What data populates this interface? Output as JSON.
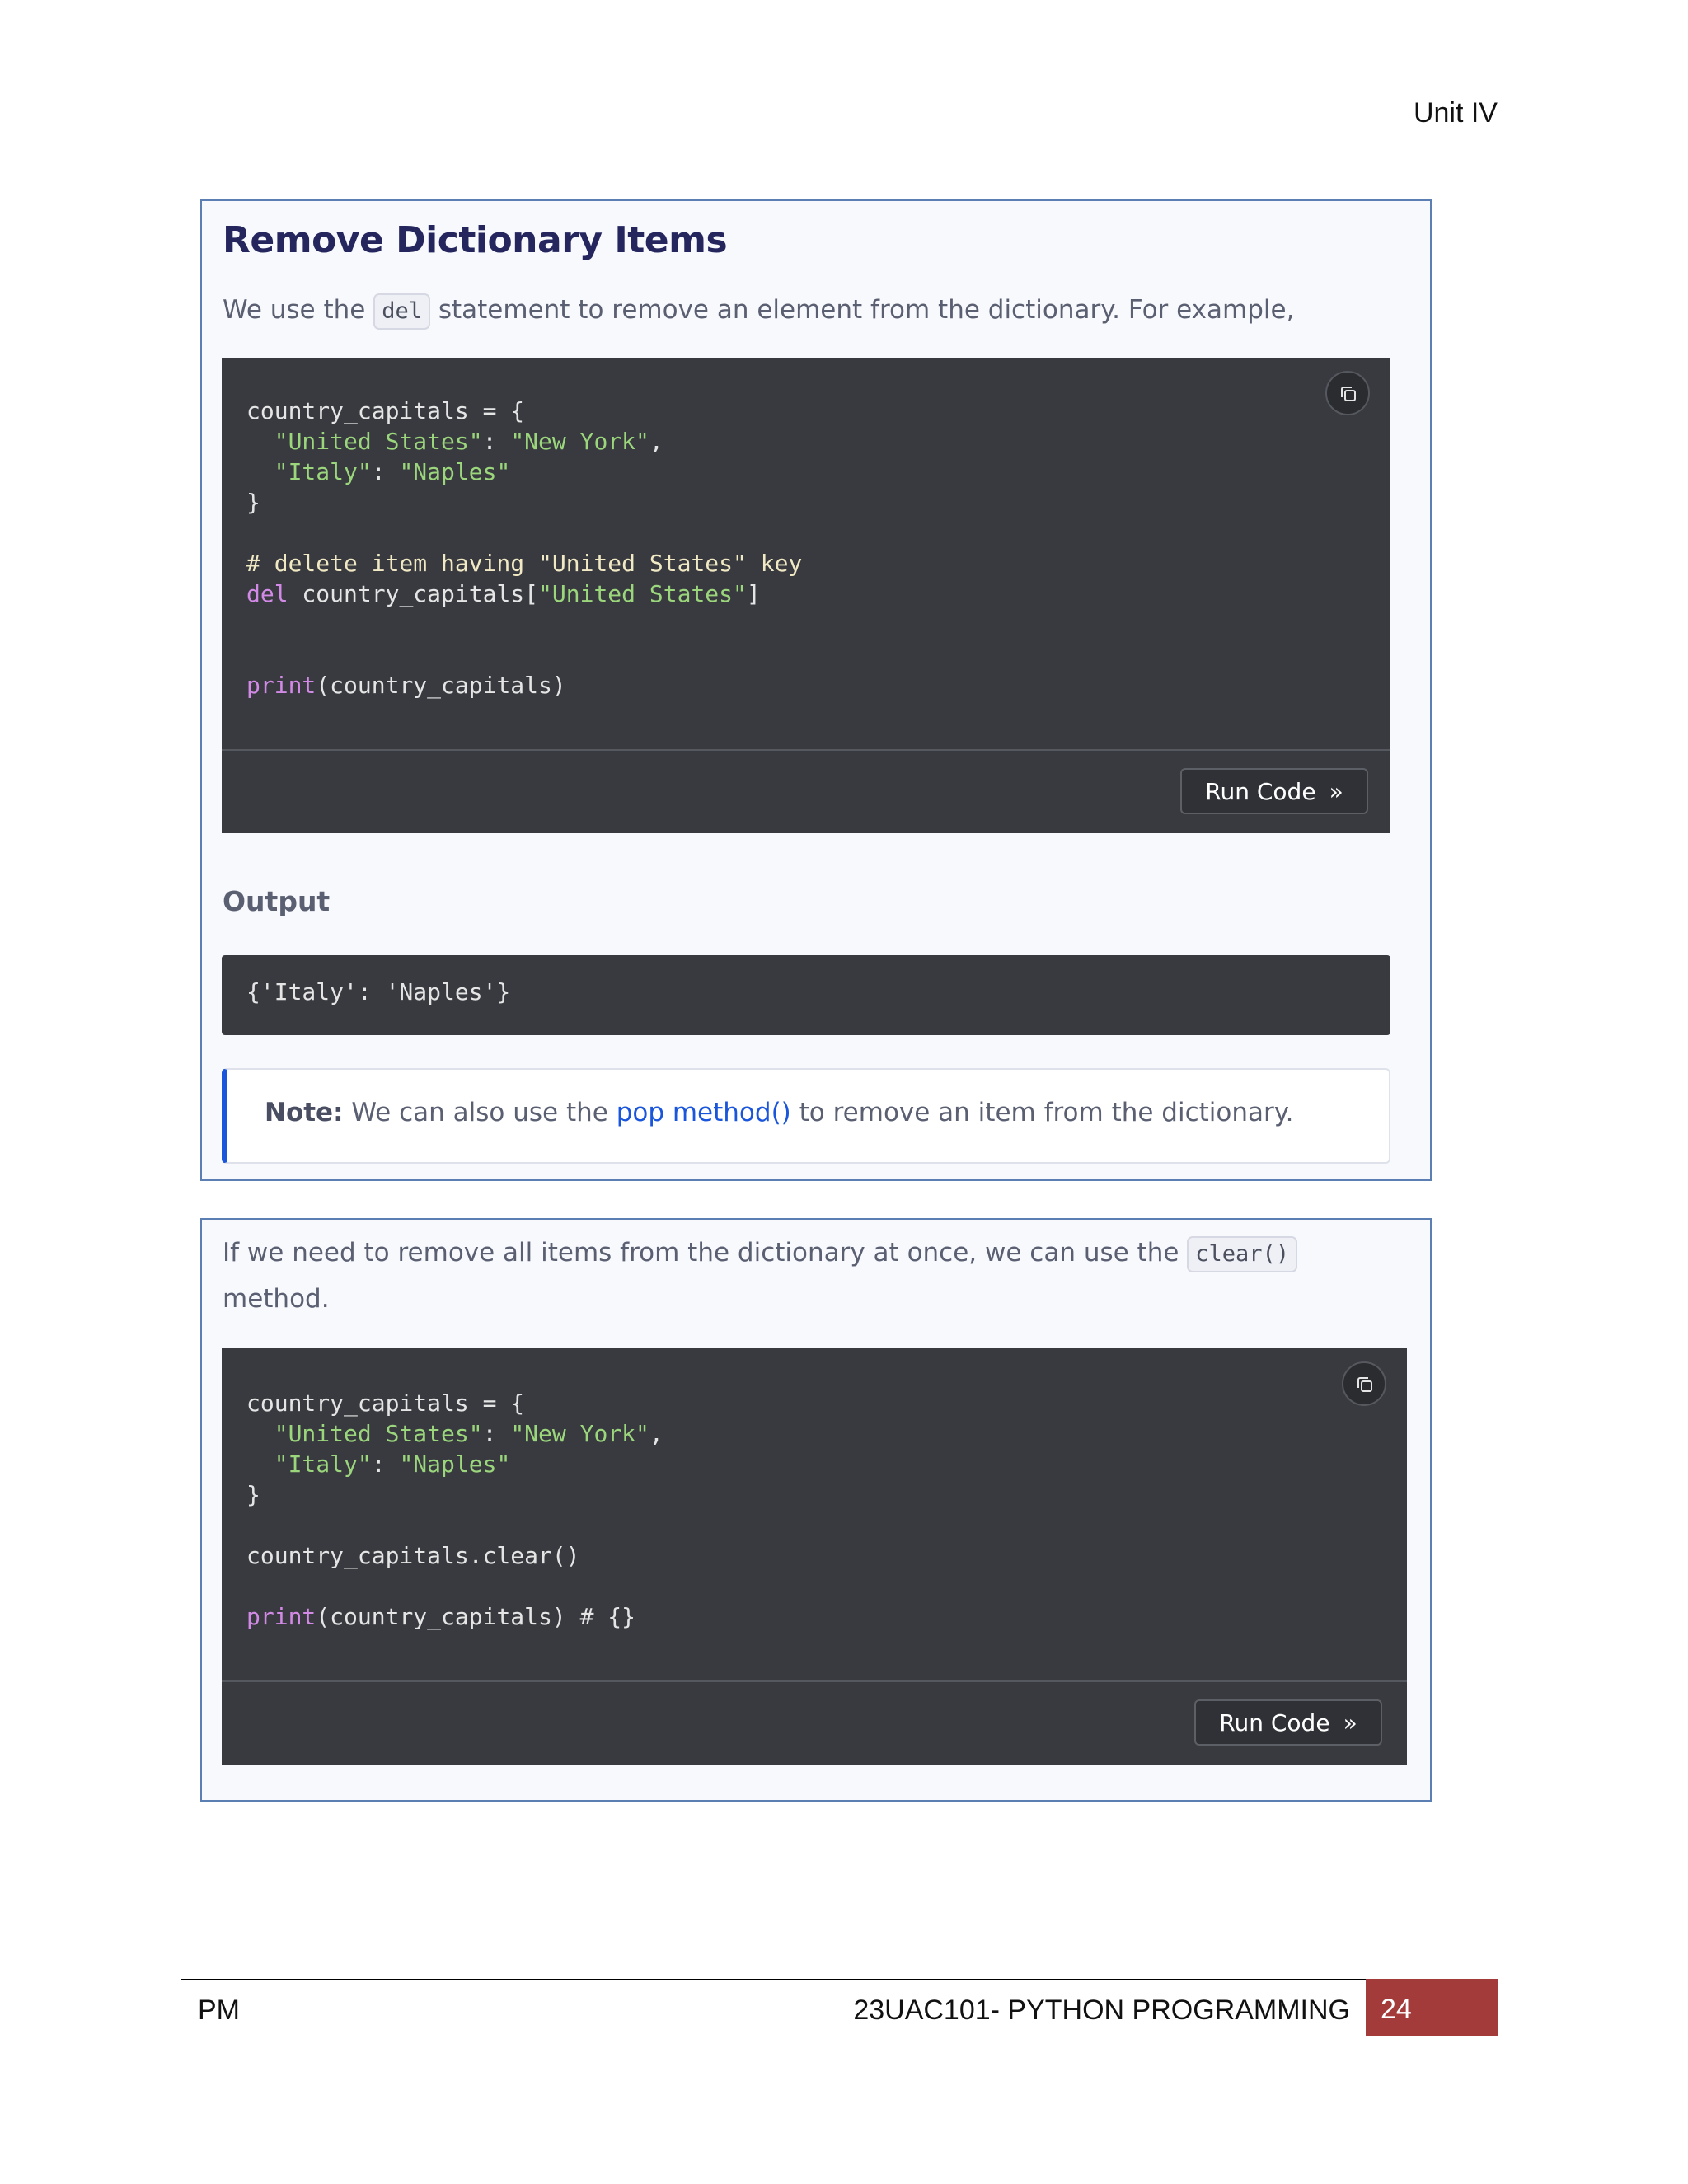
{
  "header": {
    "unit": "Unit IV"
  },
  "section1": {
    "title": "Remove Dictionary Items",
    "intro_before": "We use the ",
    "intro_code": "del",
    "intro_after": " statement to remove an element from the dictionary. For example,",
    "code": {
      "line1": "country_capitals = {",
      "line2_key": "\"United States\"",
      "line2_sep": ": ",
      "line2_val": "\"New York\"",
      "line2_end": ",",
      "line3_key": "\"Italy\"",
      "line3_sep": ": ",
      "line3_val": "\"Naples\"",
      "line4": "}",
      "comment": "# delete item having \"United States\" key",
      "del_kw": "del",
      "del_rest_before": " country_capitals[",
      "del_str": "\"United States\"",
      "del_rest_after": "]",
      "print_kw": "print",
      "print_rest": "(country_capitals)"
    },
    "run_label": "Run Code",
    "output_label": "Output",
    "output_text": "{'Italy': 'Naples'}",
    "note_bold": "Note:",
    "note_before": " We can also use the ",
    "note_link": "pop method()",
    "note_after": " to remove an item from the dictionary."
  },
  "section2": {
    "intro_before": "If we need to remove all items from the dictionary at once, we can use the ",
    "intro_code": "clear()",
    "intro_line2": "method.",
    "code": {
      "line1": "country_capitals = {",
      "line2_key": "\"United States\"",
      "line2_sep": ": ",
      "line2_val": "\"New York\"",
      "line2_end": ",",
      "line3_key": "\"Italy\"",
      "line3_sep": ": ",
      "line3_val": "\"Naples\"",
      "line4": "}",
      "clear_line": "country_capitals.clear()",
      "print_kw": "print",
      "print_rest": "(country_capitals) # {}"
    },
    "run_label": "Run Code"
  },
  "footer": {
    "left": "PM",
    "course": "23UAC101- PYTHON PROGRAMMING",
    "page": "24"
  },
  "colors": {
    "title": "#25265e",
    "code_bg": "#383a3f",
    "string": "#9bd67c",
    "keyword": "#d28ae6",
    "link": "#1a56db",
    "page_box": "#a33b3a"
  },
  "icons": [
    "copy-icon",
    "double-chevron-right-icon"
  ]
}
